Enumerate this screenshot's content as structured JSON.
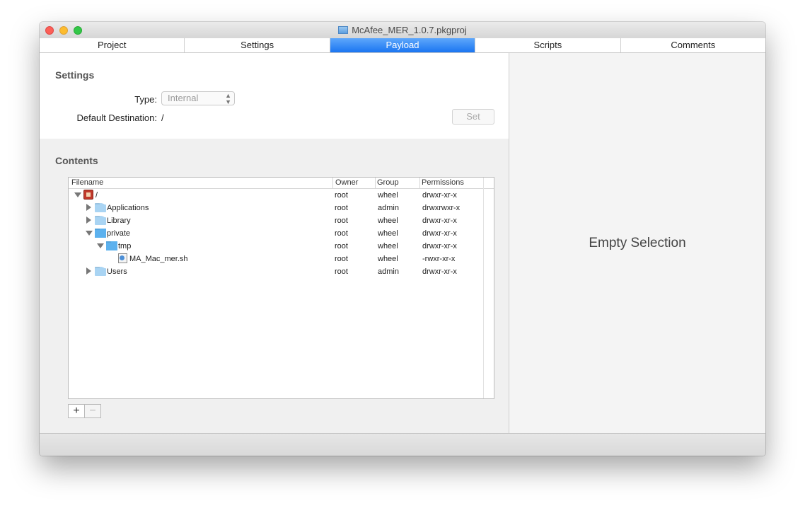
{
  "window": {
    "title": "McAfee_MER_1.0.7.pkgproj"
  },
  "tabs": [
    {
      "label": "Project"
    },
    {
      "label": "Settings"
    },
    {
      "label": "Payload"
    },
    {
      "label": "Scripts"
    },
    {
      "label": "Comments"
    }
  ],
  "active_tab": "Payload",
  "settings": {
    "title": "Settings",
    "type_label": "Type:",
    "type_value": "Internal",
    "destination_label": "Default Destination:",
    "destination_value": "/",
    "set_button": "Set"
  },
  "contents": {
    "title": "Contents",
    "columns": [
      "Filename",
      "Owner",
      "Group",
      "Permissions"
    ],
    "rows": [
      {
        "name": "/",
        "owner": "root",
        "group": "wheel",
        "permissions": "drwxr-xr-x",
        "icon": "volume-icon",
        "depth": 0,
        "disclosure": "expanded"
      },
      {
        "name": "Applications",
        "owner": "root",
        "group": "admin",
        "permissions": "drwxrwxr-x",
        "icon": "folder-icon",
        "depth": 1,
        "disclosure": "collapsed"
      },
      {
        "name": "Library",
        "owner": "root",
        "group": "wheel",
        "permissions": "drwxr-xr-x",
        "icon": "folder-icon",
        "depth": 1,
        "disclosure": "collapsed"
      },
      {
        "name": "private",
        "owner": "root",
        "group": "wheel",
        "permissions": "drwxr-xr-x",
        "icon": "folder-icon",
        "depth": 1,
        "disclosure": "expanded"
      },
      {
        "name": "tmp",
        "owner": "root",
        "group": "wheel",
        "permissions": "drwxr-xr-x",
        "icon": "folder-icon",
        "depth": 2,
        "disclosure": "expanded"
      },
      {
        "name": "MA_Mac_mer.sh",
        "owner": "root",
        "group": "wheel",
        "permissions": "-rwxr-xr-x",
        "icon": "script-file-icon",
        "depth": 3,
        "disclosure": "none"
      },
      {
        "name": "Users",
        "owner": "root",
        "group": "admin",
        "permissions": "drwxr-xr-x",
        "icon": "folder-icon",
        "depth": 1,
        "disclosure": "collapsed"
      }
    ],
    "add_button": "+",
    "remove_button": "−"
  },
  "inspector": {
    "empty_text": "Empty Selection"
  },
  "colors": {
    "accent": "#1a75f1",
    "folder": "#5cb1ee",
    "close": "#fc5f57",
    "minimize": "#fdbc2e",
    "zoom": "#33c748"
  }
}
